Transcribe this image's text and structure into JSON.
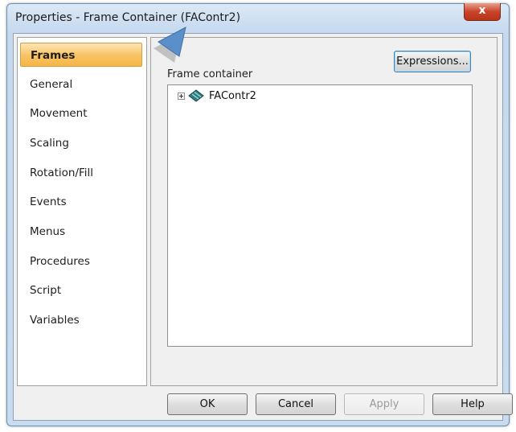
{
  "window": {
    "title": "Properties - Frame Container (FAContr2)",
    "close_label": "x"
  },
  "nav": {
    "items": [
      {
        "label": "Frames",
        "selected": true
      },
      {
        "label": "General",
        "selected": false
      },
      {
        "label": "Movement",
        "selected": false
      },
      {
        "label": "Scaling",
        "selected": false
      },
      {
        "label": "Rotation/Fill",
        "selected": false
      },
      {
        "label": "Events",
        "selected": false
      },
      {
        "label": "Menus",
        "selected": false
      },
      {
        "label": "Procedures",
        "selected": false
      },
      {
        "label": "Script",
        "selected": false
      },
      {
        "label": "Variables",
        "selected": false
      }
    ]
  },
  "panel": {
    "expressions_label": "Expressions...",
    "group_label": "Frame container",
    "tree": {
      "root_label": "FAContr2",
      "root_icon": "frame-container-icon"
    }
  },
  "buttons": {
    "ok": "OK",
    "cancel": "Cancel",
    "apply": "Apply",
    "help": "Help",
    "apply_enabled": false
  },
  "colors": {
    "selected_tab": "#f8c262",
    "title_bar": "#c6d9ee",
    "close_button": "#c9432a",
    "pointer_arrow": "#5b8fc9"
  }
}
